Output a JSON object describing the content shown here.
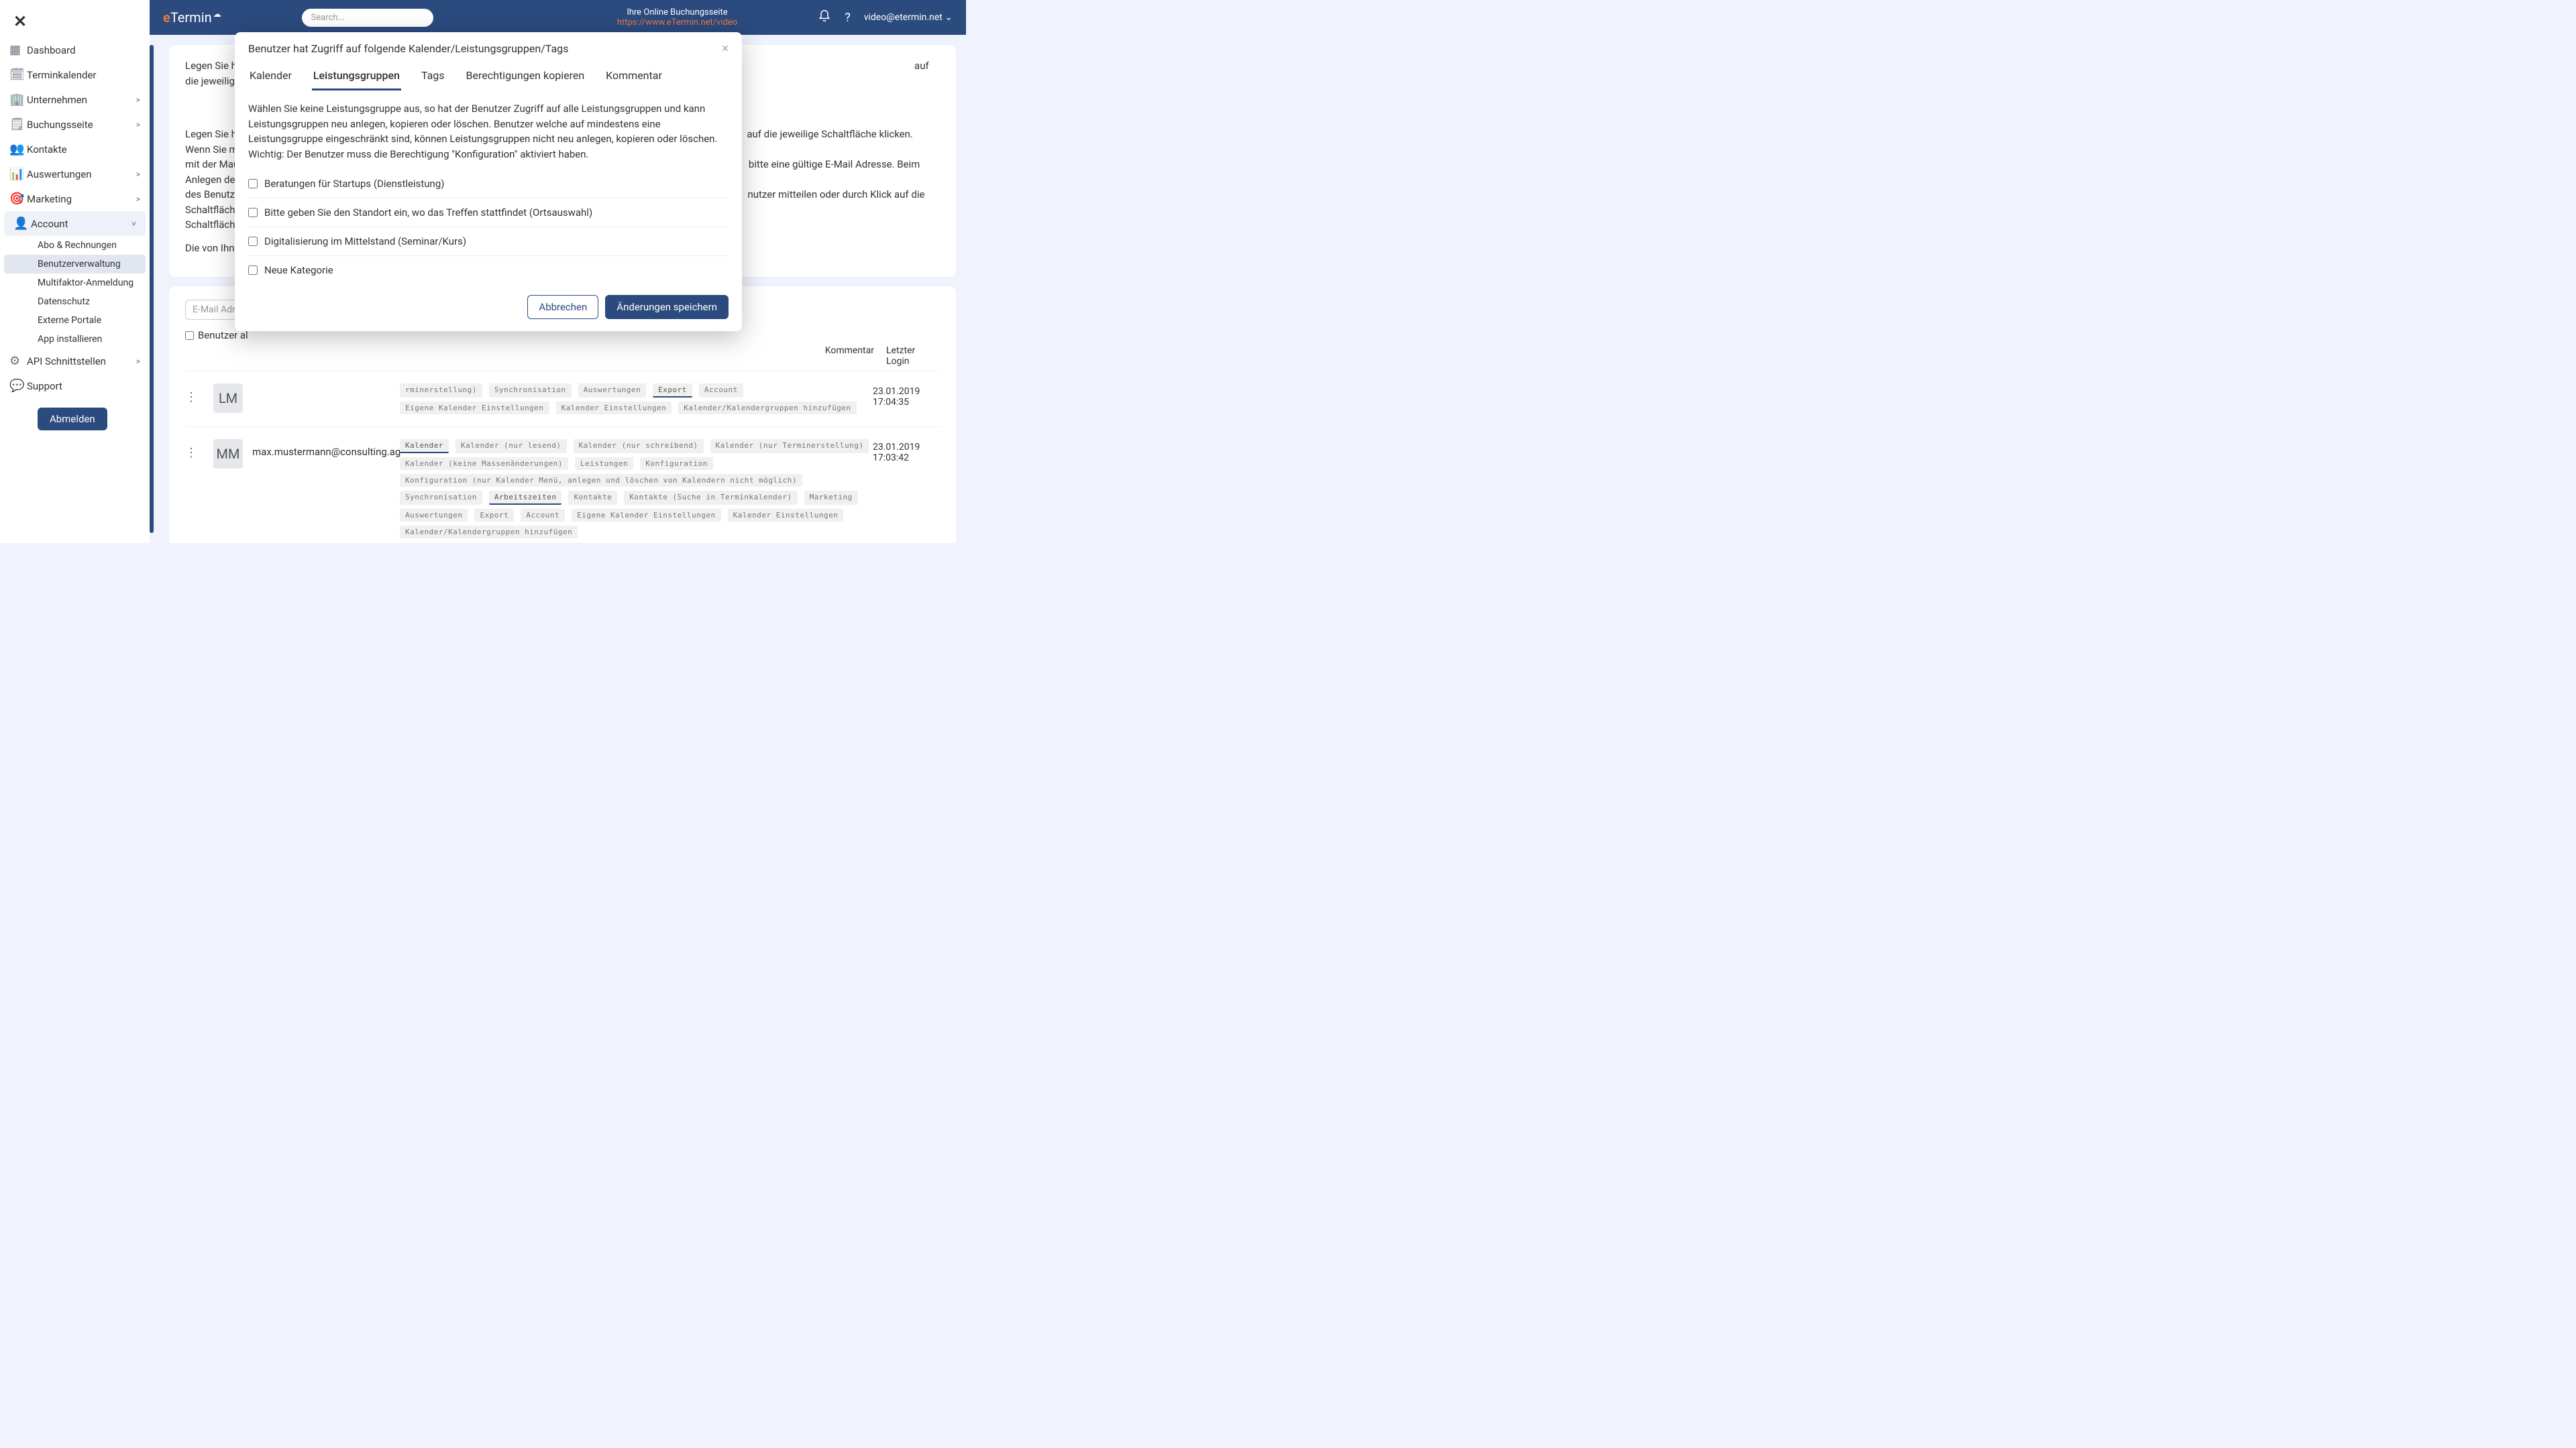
{
  "brand": {
    "prefix": "e",
    "rest": "Termin",
    "cloud": "☁"
  },
  "header": {
    "search_placeholder": "Search...",
    "booking_label": "Ihre Online Buchungsseite",
    "booking_url": "https://www.eTermin.net/video",
    "user_email": "video@etermin.net"
  },
  "sidebar": {
    "items": [
      {
        "icon": "dashboard",
        "label": "Dashboard"
      },
      {
        "icon": "calendar",
        "label": "Terminkalender"
      },
      {
        "icon": "company",
        "label": "Unternehmen",
        "chevron": ">"
      },
      {
        "icon": "booking",
        "label": "Buchungsseite",
        "chevron": ">"
      },
      {
        "icon": "contacts",
        "label": "Kontakte"
      },
      {
        "icon": "reports",
        "label": "Auswertungen",
        "chevron": ">"
      },
      {
        "icon": "marketing",
        "label": "Marketing",
        "chevron": ">"
      },
      {
        "icon": "account",
        "label": "Account",
        "chevron": "˅",
        "active": true
      },
      {
        "icon": "api",
        "label": "API Schnittstellen",
        "chevron": ">"
      },
      {
        "icon": "support",
        "label": "Support"
      }
    ],
    "sub_items": [
      {
        "label": "Abo & Rechnungen"
      },
      {
        "label": "Benutzerverwaltung",
        "active": true
      },
      {
        "label": "Multifaktor-Anmeldung"
      },
      {
        "label": "Datenschutz"
      },
      {
        "label": "Externe Portale"
      },
      {
        "label": "App installieren"
      }
    ],
    "logout": "Abmelden"
  },
  "intro": {
    "text1_a": "Legen Sie hier ",
    "text1_b": "auf die jeweilige Schaltfläche klicken. Wenn Sie mit der Maus ü",
    "text1_c": "bitte eine gültige E-Mail Adresse. Beim Anlegen des Benutzers ",
    "text1_d": "nutzer mitteilen oder durch Klick auf die Schaltfläche \"Pa",
    "text2": "Die von Ihnen a"
  },
  "filter": {
    "placeholder": "E-Mail Adresse",
    "checkbox_label": "Benutzer al"
  },
  "table_headers": {
    "kommentar": "Kommentar",
    "login": "Letzter Login"
  },
  "users": [
    {
      "initials": "LM",
      "email": "",
      "login_date": "23.01.2019",
      "login_time": "17:04:35",
      "tags_full": [
        {
          "t": "",
          "a": 1
        }
      ],
      "tags": [
        {
          "t": "rminerstellung)"
        },
        {
          "t": "Synchronisation"
        },
        {
          "t": "Auswertungen"
        },
        {
          "t": "Export",
          "a": 1
        },
        {
          "t": "Account"
        },
        {
          "t": "Eigene Kalender Einstellungen"
        },
        {
          "t": "Kalender Einstellungen"
        },
        {
          "t": "Kalender/Kalendergruppen hinzufügen"
        }
      ]
    },
    {
      "initials": "MM",
      "email": "max.mustermann@consulting.ag",
      "login_date": "23.01.2019",
      "login_time": "17:03:42",
      "tags": [
        {
          "t": "Kalender",
          "a": 1
        },
        {
          "t": "Kalender (nur lesend)"
        },
        {
          "t": "Kalender (nur schreibend)"
        },
        {
          "t": "Kalender (nur Terminerstellung)"
        },
        {
          "t": "Kalender (keine Massenänderungen)"
        },
        {
          "t": "Leistungen"
        },
        {
          "t": "Konfiguration"
        },
        {
          "t": "Konfiguration (nur Kalender Menü, anlegen und löschen von Kalendern nicht möglich)"
        },
        {
          "t": "Synchronisation"
        },
        {
          "t": "Arbeitszeiten",
          "a": 1
        },
        {
          "t": "Kontakte"
        },
        {
          "t": "Kontakte (Suche in Terminkalender)"
        },
        {
          "t": "Marketing"
        },
        {
          "t": "Auswertungen"
        },
        {
          "t": "Export"
        },
        {
          "t": "Account"
        },
        {
          "t": "Eigene Kalender Einstellungen"
        },
        {
          "t": "Kalender Einstellungen"
        },
        {
          "t": "Kalender/Kalendergruppen hinzufügen"
        }
      ]
    }
  ],
  "modal": {
    "title": "Benutzer hat Zugriff auf folgende Kalender/Leistungsgruppen/Tags",
    "tabs": [
      "Kalender",
      "Leistungsgruppen",
      "Tags",
      "Berechtigungen kopieren",
      "Kommentar"
    ],
    "active_tab": 1,
    "description": "Wählen Sie keine Leistungsgruppe aus, so hat der Benutzer Zugriff auf alle Leistungsgruppen und kann Leistungsgruppen neu anlegen, kopieren oder löschen. Benutzer welche auf mindestens eine Leistungsgruppe eingeschränkt sind, können Leistungsgruppen nicht neu anlegen, kopieren oder löschen.\nWichtig: Der Benutzer muss die Berechtigung \"Konfiguration\" aktiviert haben.",
    "checks": [
      "Beratungen für Startups (Dienstleistung)",
      "Bitte geben Sie den Standort ein, wo das Treffen stattfindet (Ortsauswahl)",
      "Digitalisierung im Mittelstand (Seminar/Kurs)",
      "Neue Kategorie"
    ],
    "cancel": "Abbrechen",
    "save": "Änderungen speichern"
  }
}
